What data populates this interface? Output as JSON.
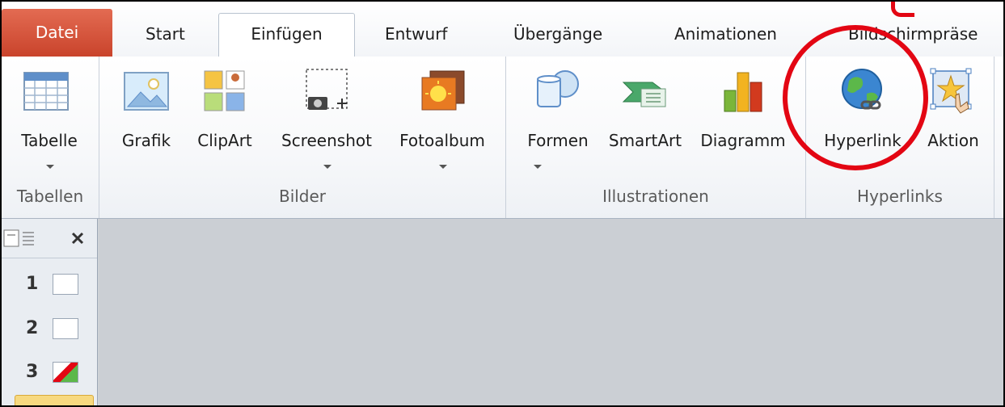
{
  "tabs": {
    "file": "Datei",
    "start": "Start",
    "insert": "Einfügen",
    "design": "Entwurf",
    "transitions": "Übergänge",
    "animations": "Animationen",
    "slideshow": "Bildschirmpräse"
  },
  "groups": {
    "tables": {
      "label": "Tabellen",
      "table": "Tabelle"
    },
    "images": {
      "label": "Bilder",
      "picture": "Grafik",
      "clipart": "ClipArt",
      "screenshot": "Screenshot",
      "album": "Fotoalbum"
    },
    "illustrations": {
      "label": "Illustrationen",
      "shapes": "Formen",
      "smartart": "SmartArt",
      "chart": "Diagramm"
    },
    "links": {
      "label": "Hyperlinks",
      "hyperlink": "Hyperlink",
      "action": "Aktion"
    }
  },
  "slides": [
    "1",
    "2",
    "3"
  ],
  "colors": {
    "file_tab": "#c9432b",
    "annotation": "#e30613"
  }
}
